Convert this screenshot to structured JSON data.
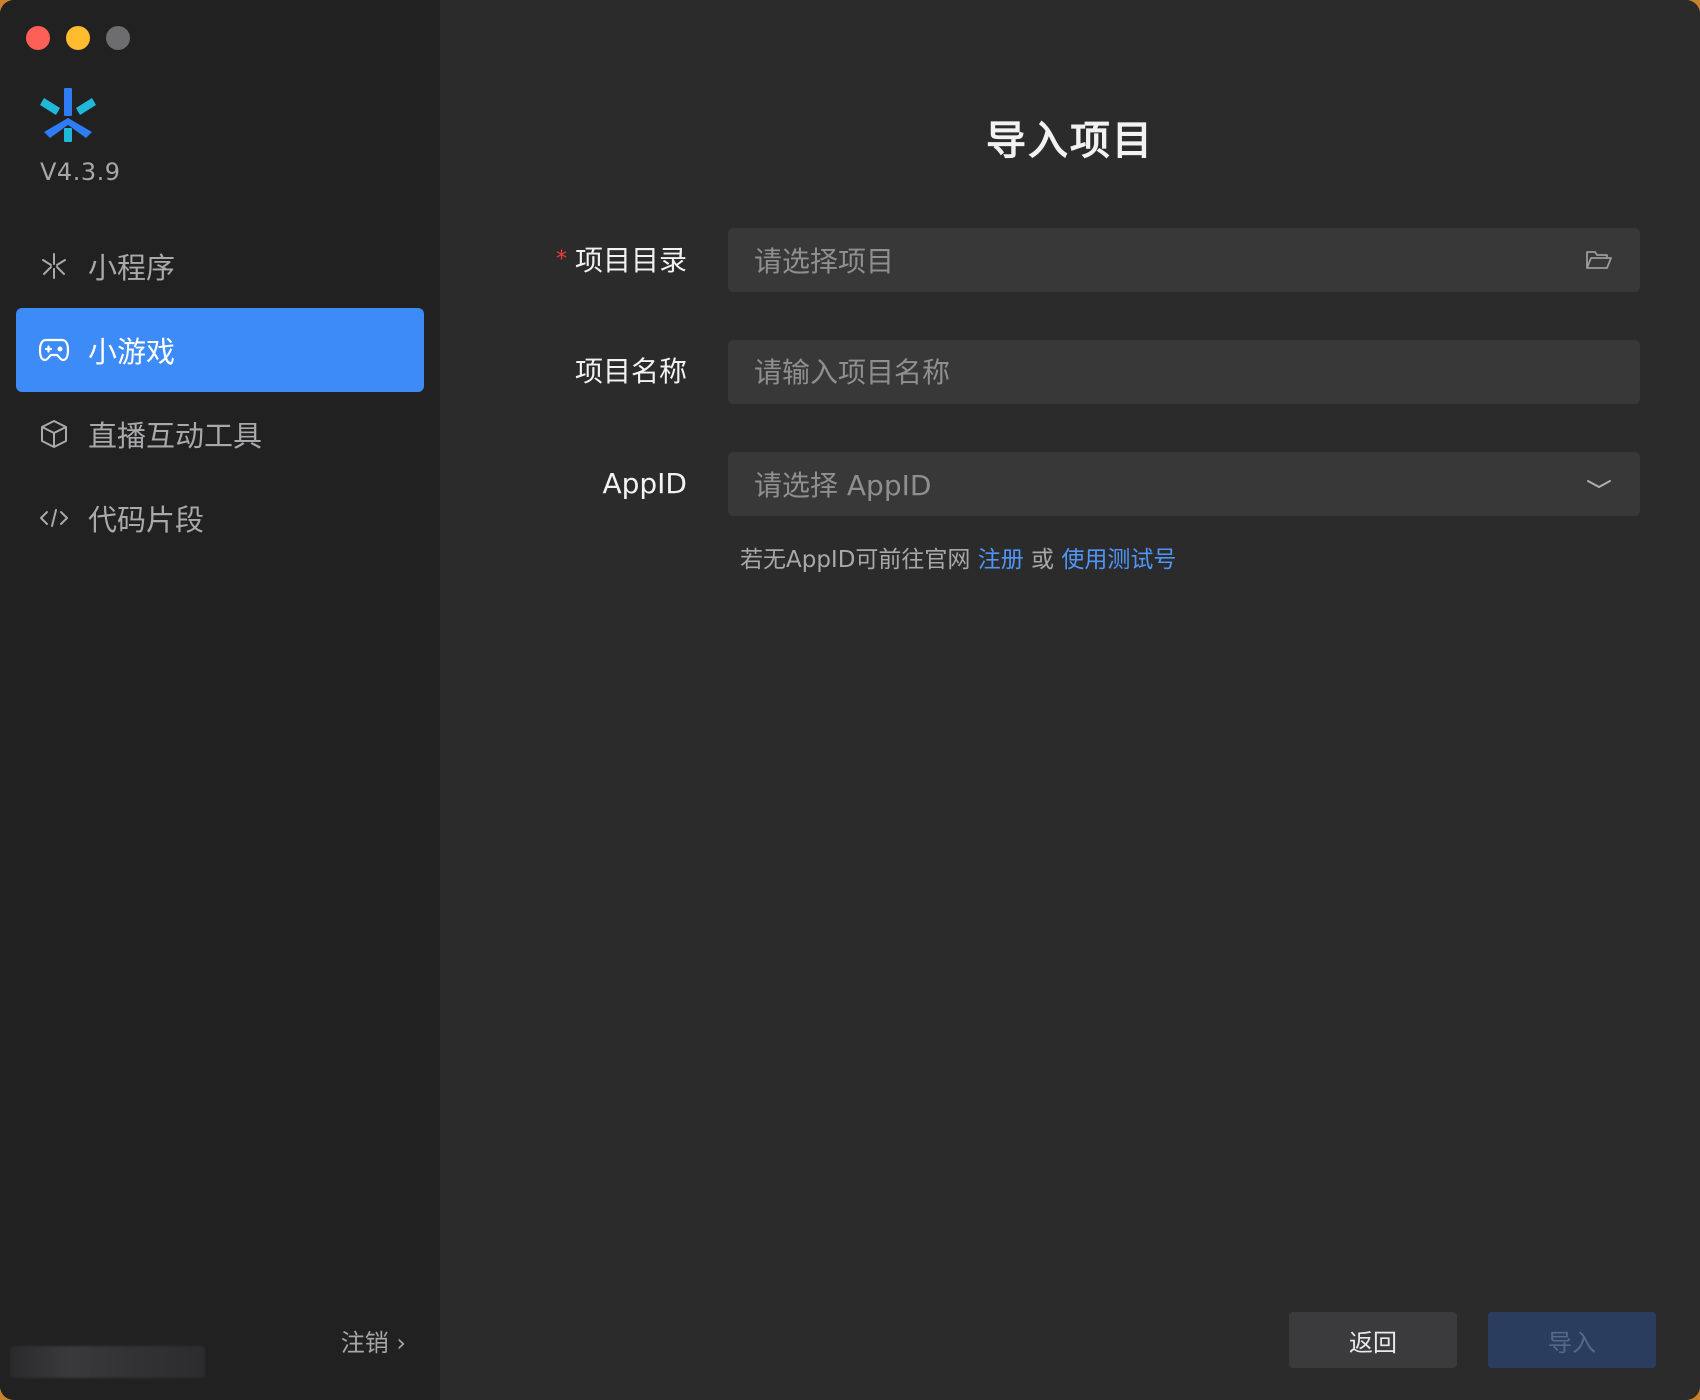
{
  "sidebar": {
    "version": "V4.3.9",
    "items": [
      {
        "label": "小程序",
        "icon": "asterisk-icon",
        "active": false
      },
      {
        "label": "小游戏",
        "icon": "gamepad-icon",
        "active": true
      },
      {
        "label": "直播互动工具",
        "icon": "cube-icon",
        "active": false
      },
      {
        "label": "代码片段",
        "icon": "code-icon",
        "active": false
      }
    ],
    "logout": "注销 ›"
  },
  "main": {
    "title": "导入项目",
    "fields": {
      "directory": {
        "label": "项目目录",
        "required_mark": "*",
        "placeholder": "请选择项目"
      },
      "name": {
        "label": "项目名称",
        "placeholder": "请输入项目名称"
      },
      "appid": {
        "label": "AppID",
        "placeholder": "请选择 AppID"
      }
    },
    "hint": {
      "prefix": "若无AppID可前往官网 ",
      "register_link": "注册",
      "middle": " 或 ",
      "test_link": "使用测试号"
    },
    "buttons": {
      "back": "返回",
      "import": "导入"
    }
  },
  "colors": {
    "accent": "#3c8bf7",
    "link": "#4f95fb",
    "required": "#f23c3c",
    "import_disabled_bg": "#2b3d5f"
  }
}
